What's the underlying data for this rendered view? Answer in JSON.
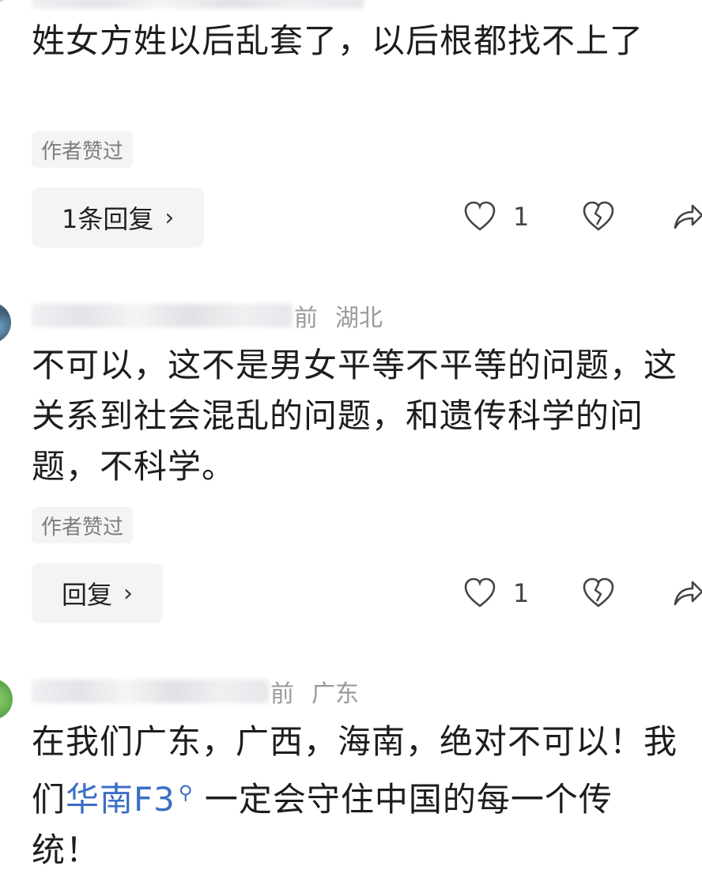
{
  "comments": [
    {
      "text": "姓女方姓以后乱套了，以后根都找不上了",
      "author_tag": "作者赞过",
      "reply_label": "1条回复",
      "like_count": "1"
    },
    {
      "location": "湖北",
      "meta_partial": "前",
      "text": "不可以，这不是男女平等不平等的问题，这关系到社会混乱的问题，和遗传科学的问题，不科学。",
      "author_tag": "作者赞过",
      "reply_label": "回复",
      "like_count": "1"
    },
    {
      "location": "广东",
      "meta_partial": "前",
      "text_before": "在我们广东，广西，海南，绝对不可以！我们",
      "link_text": "华南F3",
      "text_after": "一定会守住中国的每一个传统！"
    }
  ],
  "icons": {
    "like": "heart-outline-icon",
    "dislike": "broken-heart-icon",
    "share": "share-arrow-icon",
    "search": "search-icon",
    "chevron": "chevron-right-icon"
  },
  "colors": {
    "link": "#3a6fc4",
    "meta": "#9a9a9a",
    "button_bg": "#f4f4f4"
  }
}
